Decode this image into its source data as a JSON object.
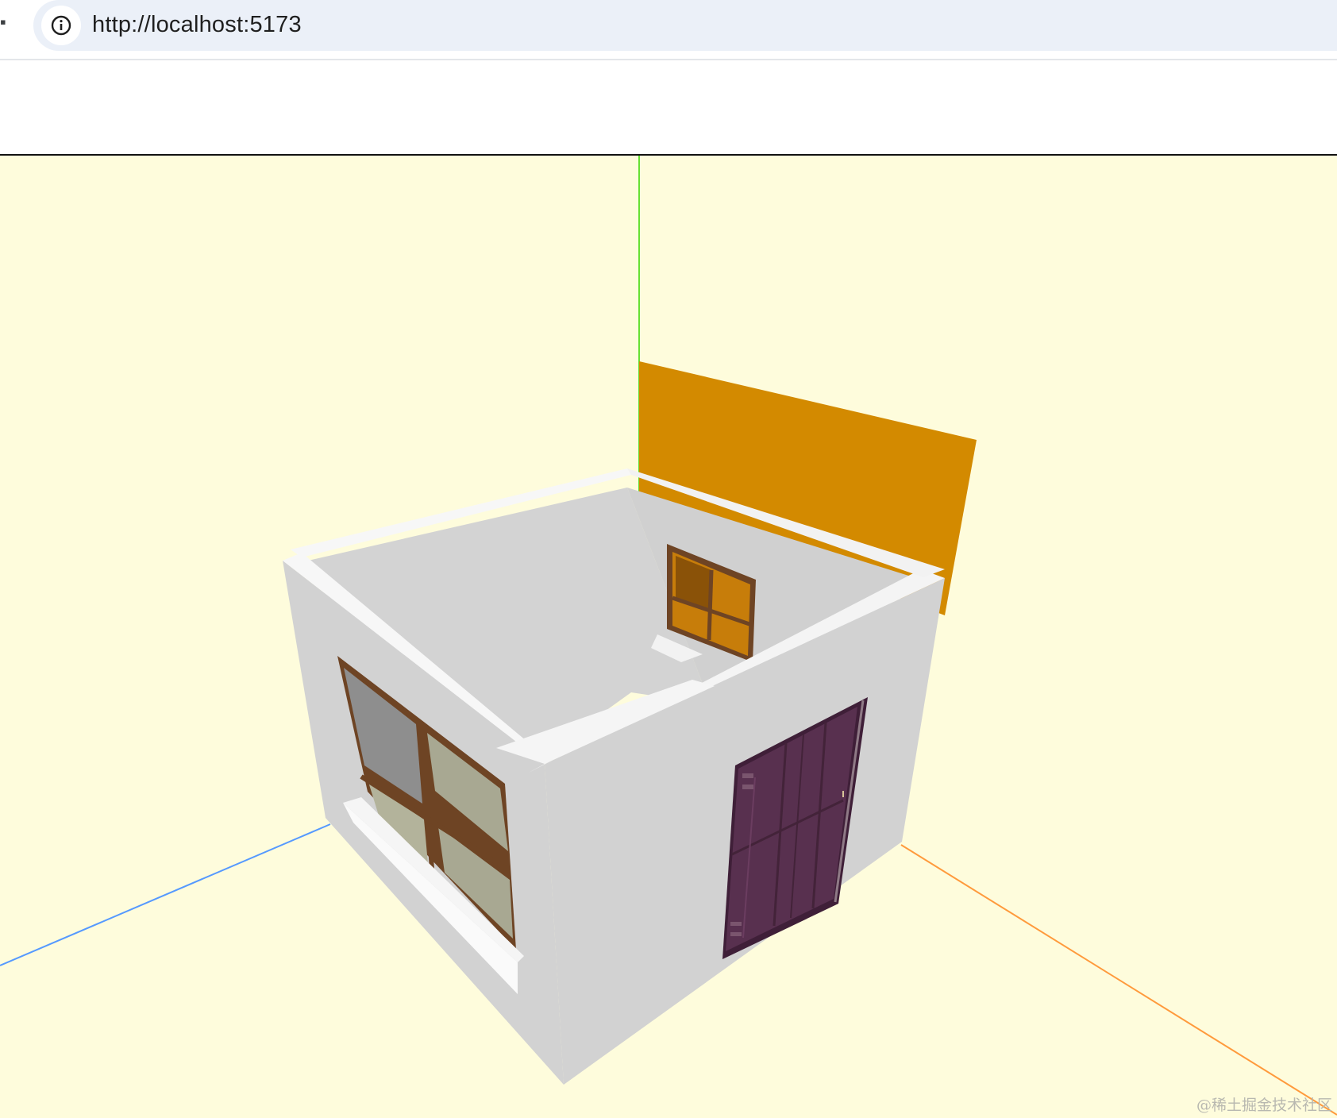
{
  "browser": {
    "url": "http://localhost:5173",
    "info_icon": "info-icon"
  },
  "scene": {
    "background_color": "#fefcdc",
    "axis_colors": {
      "x_axis": "#ff9a3c",
      "y_axis": "#66e033",
      "z_axis": "#5599ff"
    },
    "back_plane_color": "#d38a00",
    "wall_color": "#d2d2d2",
    "wall_top_color": "#f6f6f6",
    "door_color": "#58304f",
    "window_frame_color": "#6e4424",
    "small_window_color": "#c77d0a"
  },
  "watermark": "@稀土掘金技术社区"
}
